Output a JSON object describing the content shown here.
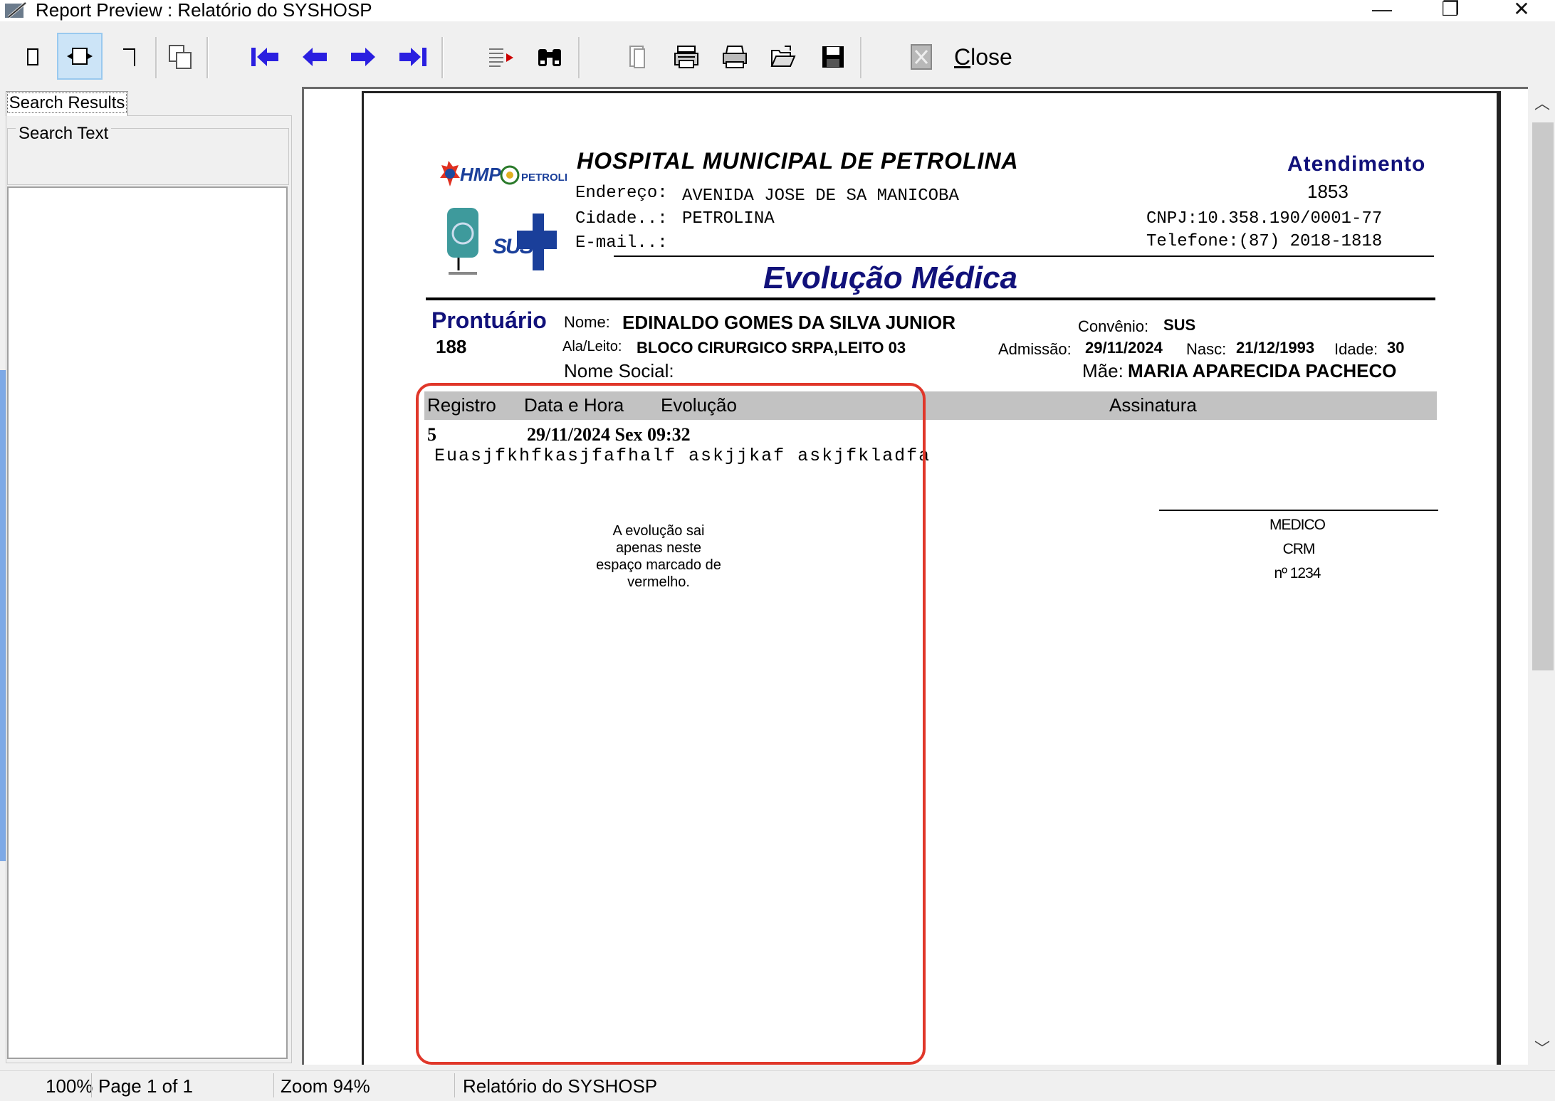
{
  "window": {
    "title": "Report Preview : Relatório do SYSHOSP",
    "minimize": "—",
    "maximize": "❐",
    "close": "✕"
  },
  "toolbar": {
    "close_label_first": "C",
    "close_label_rest": "lose"
  },
  "left_panel": {
    "tab": "Search Results",
    "search_group_label": "Search Text"
  },
  "report": {
    "hospital_name": "HOSPITAL MUNICIPAL DE PETROLINA",
    "logo_hmp": "HMP",
    "logo_petrolina": "PETROLINA",
    "logo_sus": "SUS",
    "endereco_label": "Endereço:",
    "endereco_value": "AVENIDA JOSE DE SA MANICOBA",
    "cidade_label": "Cidade..:",
    "cidade_value": "PETROLINA",
    "email_label": "E-mail..:",
    "atendimento_label": "Atendimento",
    "atendimento_value": "1853",
    "cnpj": "CNPJ:10.358.190/0001-77",
    "telefone": "Telefone:(87)  2018-1818",
    "doc_title": "Evolução Médica",
    "prontuario_label": "Prontuário",
    "prontuario_value": "188",
    "nome_label": "Nome:",
    "nome_value": "EDINALDO GOMES DA SILVA JUNIOR",
    "convenio_label": "Convênio:",
    "convenio_value": "SUS",
    "ala_label": "Ala/Leito:",
    "ala_value": "BLOCO CIRURGICO SRPA,LEITO 03",
    "admissao_label": "Admissão:",
    "admissao_value": "29/11/2024",
    "nasc_label": "Nasc:",
    "nasc_value": "21/12/1993",
    "idade_label": "Idade:",
    "idade_value": "30",
    "nome_social_label": "Nome Social:",
    "mae_label": "Mãe:",
    "mae_value": "MARIA APARECIDA PACHECO",
    "columns": [
      "Registro",
      "Data e Hora",
      "Evolução",
      "Assinatura"
    ],
    "record": {
      "registro": "5",
      "data_hora": "29/11/2024 Sex 09:32",
      "evolucao": "Euasjfkhfkasjfafhalf askjjkaf askjfkladfa"
    },
    "signature": [
      "MEDICO",
      "CRM",
      "nº 1234"
    ],
    "note": "A evolução sai apenas neste espaço marcado de vermelho."
  },
  "statusbar": {
    "progress": "100%",
    "page": "Page 1 of 1",
    "zoom": "Zoom 94%",
    "report_name": "Relatório do SYSHOSP"
  },
  "colors": {
    "accent_blue": "#2a1fe0",
    "title_navy": "#11117a",
    "annotation_red": "#e0372a",
    "header_gray": "#c2c2c2"
  }
}
